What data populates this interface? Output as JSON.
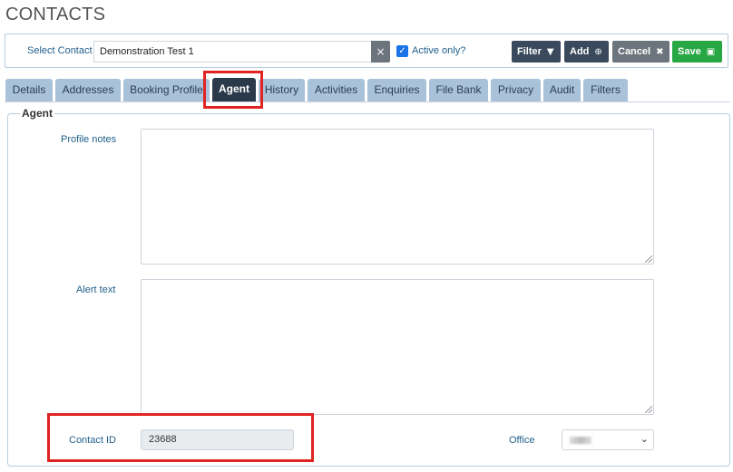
{
  "page": {
    "title": "CONTACTS"
  },
  "toolbar": {
    "select_contact_label": "Select Contact",
    "contact_value": "Demonstration Test 1",
    "clear_icon": "×",
    "active_only_label": "Active only?",
    "active_only_checked": true,
    "filter_label": "Filter",
    "add_label": "Add",
    "cancel_label": "Cancel",
    "save_label": "Save"
  },
  "tabs": [
    {
      "label": "Details"
    },
    {
      "label": "Addresses"
    },
    {
      "label": "Booking Profile"
    },
    {
      "label": "Agent"
    },
    {
      "label": "History"
    },
    {
      "label": "Activities"
    },
    {
      "label": "Enquiries"
    },
    {
      "label": "File Bank"
    },
    {
      "label": "Privacy"
    },
    {
      "label": "Audit"
    },
    {
      "label": "Filters"
    }
  ],
  "active_tab": "Agent",
  "agent": {
    "legend": "Agent",
    "profile_notes_label": "Profile notes",
    "profile_notes_value": "",
    "alert_text_label": "Alert text",
    "alert_text_value": "",
    "contact_id_label": "Contact ID",
    "contact_id_value": "23688",
    "office_label": "Office"
  },
  "colors": {
    "accent_dark": "#3a4a5c",
    "save_green": "#28a745",
    "cancel_grey": "#6c757d",
    "tab_bg": "#a9c1d9",
    "tab_active_bg": "#2b3a4a",
    "highlight_red": "#e02424",
    "label_blue": "#1f5f8b"
  },
  "icons": {
    "filter": "filter-icon",
    "add": "plus-circle-icon",
    "cancel": "close-icon",
    "save": "floppy-disk-icon",
    "select_chevron": "chevron-down-icon"
  }
}
